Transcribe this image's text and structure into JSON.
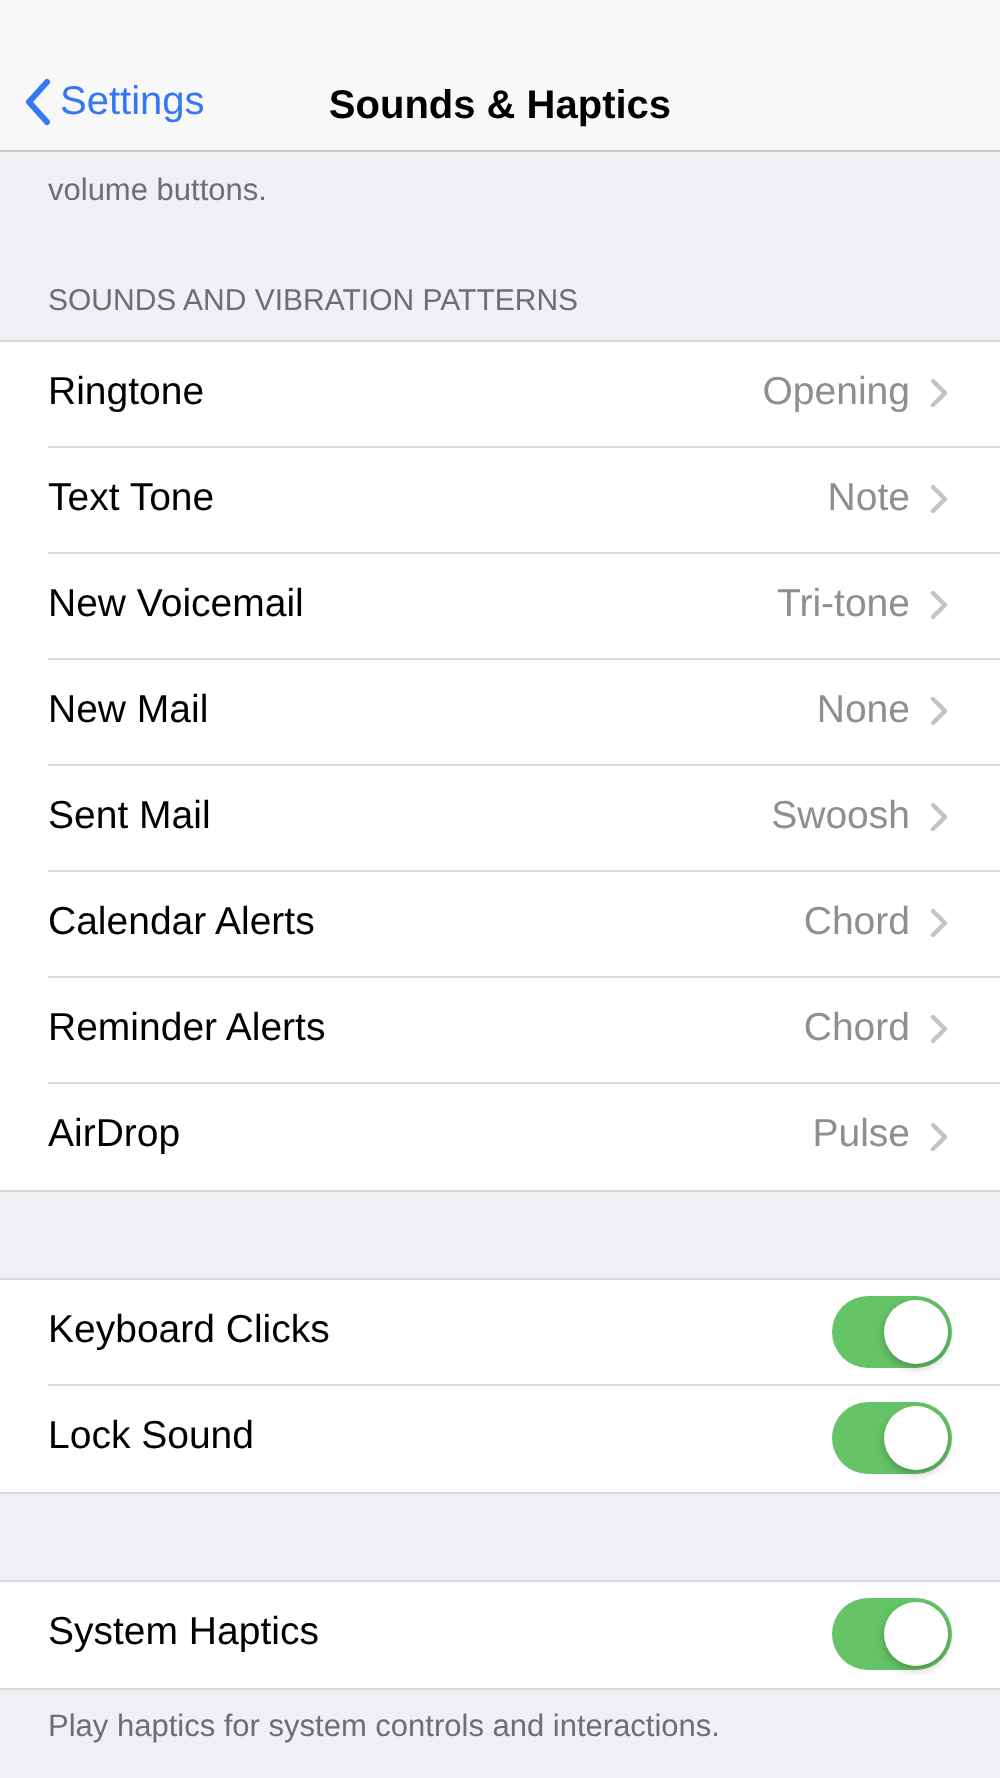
{
  "nav": {
    "back_label": "Settings",
    "title": "Sounds & Haptics"
  },
  "top_note": "volume buttons.",
  "section_header": "SOUNDS AND VIBRATION PATTERNS",
  "sound_rows": [
    {
      "label": "Ringtone",
      "value": "Opening"
    },
    {
      "label": "Text Tone",
      "value": "Note"
    },
    {
      "label": "New Voicemail",
      "value": "Tri-tone"
    },
    {
      "label": "New Mail",
      "value": "None"
    },
    {
      "label": "Sent Mail",
      "value": "Swoosh"
    },
    {
      "label": "Calendar Alerts",
      "value": "Chord"
    },
    {
      "label": "Reminder Alerts",
      "value": "Chord"
    },
    {
      "label": "AirDrop",
      "value": "Pulse"
    }
  ],
  "toggle_rows": [
    {
      "label": "Keyboard Clicks",
      "on": true
    },
    {
      "label": "Lock Sound",
      "on": true
    }
  ],
  "haptics_row": {
    "label": "System Haptics",
    "on": true
  },
  "haptics_note": "Play haptics for system controls and interactions."
}
